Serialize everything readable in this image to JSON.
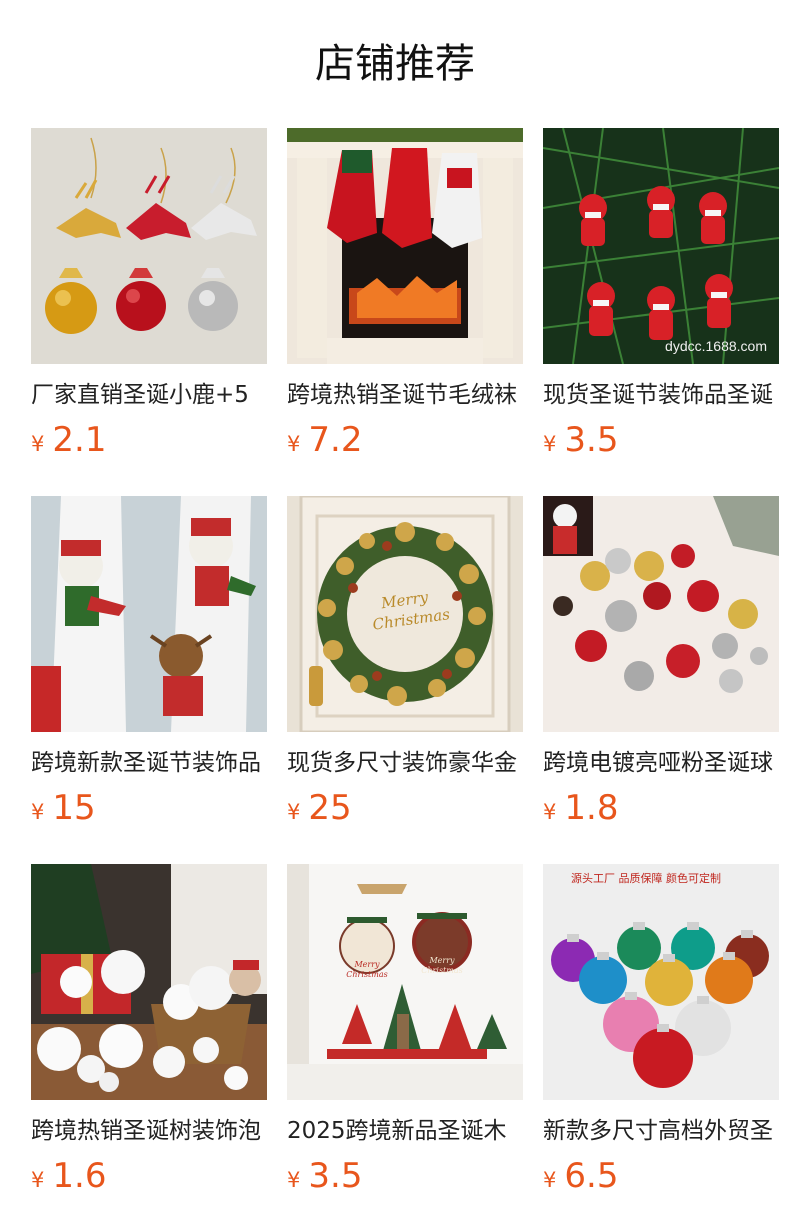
{
  "page": {
    "title": "店铺推荐"
  },
  "products": [
    {
      "name": "厂家直销圣诞小鹿+5",
      "currency": "¥",
      "price": "2.1",
      "image_icon": "reindeer-ornament-image",
      "watermark": ""
    },
    {
      "name": "跨境热销圣诞节毛绒袜",
      "currency": "¥",
      "price": "7.2",
      "image_icon": "christmas-stocking-fireplace-image",
      "watermark": ""
    },
    {
      "name": "现货圣诞节装饰品圣诞",
      "currency": "¥",
      "price": "3.5",
      "image_icon": "santa-ornament-image",
      "watermark": "dydcc.1688.com"
    },
    {
      "name": "跨境新款圣诞节装饰品",
      "currency": "¥",
      "price": "15",
      "image_icon": "curtain-tieback-doll-image",
      "watermark": ""
    },
    {
      "name": "现货多尺寸装饰豪华金",
      "currency": "¥",
      "price": "25",
      "image_icon": "christmas-wreath-image",
      "watermark": "Merry Christmas"
    },
    {
      "name": "跨境电镀亮哑粉圣诞球",
      "currency": "¥",
      "price": "1.8",
      "image_icon": "christmas-balls-image",
      "watermark": ""
    },
    {
      "name": "跨境热销圣诞树装饰泡",
      "currency": "¥",
      "price": "1.6",
      "image_icon": "foam-balls-image",
      "watermark": ""
    },
    {
      "name": "2025跨境新品圣诞木",
      "currency": "¥",
      "price": "3.5",
      "image_icon": "wooden-christmas-decor-image",
      "watermark": "Merry Christmas"
    },
    {
      "name": "新款多尺寸高档外贸圣",
      "currency": "¥",
      "price": "6.5",
      "image_icon": "colored-balls-image",
      "watermark": "源头工厂 品质保障 颜色可定制"
    }
  ],
  "colors": {
    "price": "#e8561c",
    "title": "#111111"
  }
}
